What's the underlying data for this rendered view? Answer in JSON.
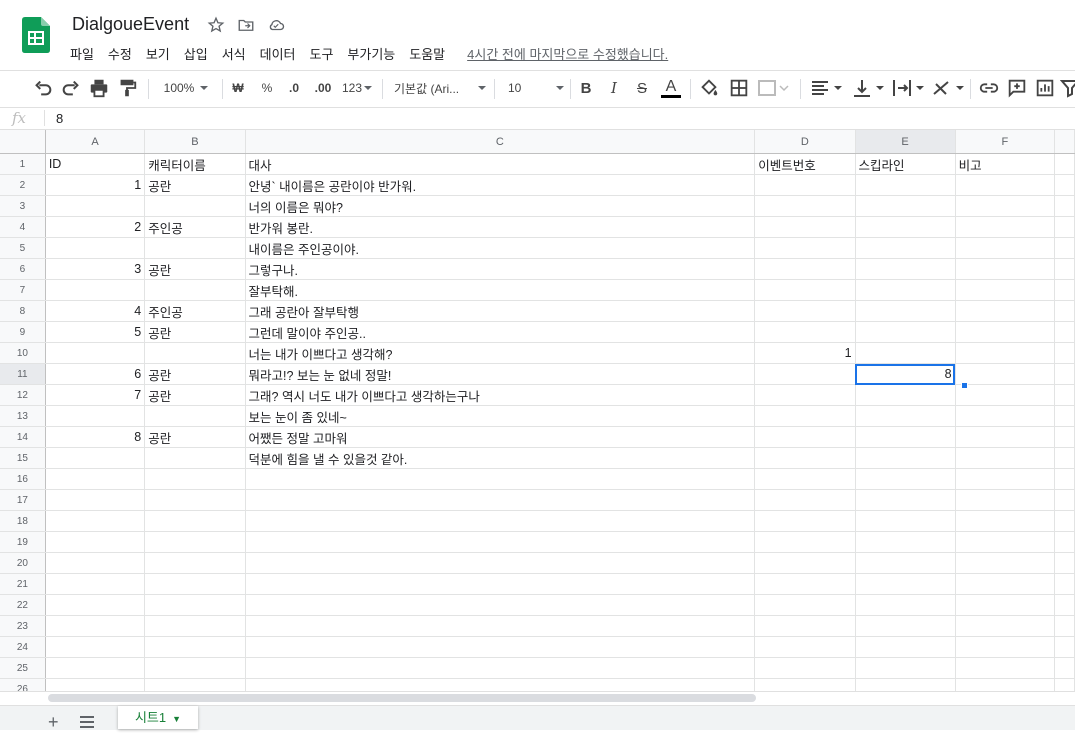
{
  "app": {
    "title": "DialgoueEvent",
    "last_edit": "4시간 전에 마지막으로 수정했습니다.",
    "menu": [
      "파일",
      "수정",
      "보기",
      "삽입",
      "서식",
      "데이터",
      "도구",
      "부가기능",
      "도움말"
    ]
  },
  "toolbar": {
    "zoom": "100%",
    "currency": "₩",
    "percent": "%",
    "decrease_decimal": ".0",
    "increase_decimal": ".00",
    "number_format": "123",
    "font": "기본값 (Ari...",
    "font_size": "10",
    "bold": "B",
    "italic": "I",
    "strike": "S",
    "text_color": "A"
  },
  "formula_bar": {
    "fx": "fx",
    "value": "8"
  },
  "colors": {
    "accent": "#1a73e8",
    "sheets_green": "#188038"
  },
  "grid": {
    "columns": [
      "A",
      "B",
      "C",
      "D",
      "E",
      "F"
    ],
    "row_numbers": [
      "1",
      "2",
      "3",
      "4",
      "5",
      "6",
      "7",
      "8",
      "9",
      "10",
      "11",
      "12",
      "13",
      "14",
      "15",
      "16",
      "17",
      "18",
      "19",
      "20",
      "21",
      "22",
      "23",
      "24",
      "25",
      "26"
    ],
    "rows": [
      [
        "ID",
        "캐릭터이름",
        "대사",
        "이벤트번호",
        "스킵라인",
        "비고"
      ],
      [
        "1",
        "공란",
        "안녕` 내이름은 공란이야 반가워.",
        "",
        "",
        ""
      ],
      [
        "",
        "",
        "너의 이름은 뭐야?",
        "",
        "",
        ""
      ],
      [
        "2",
        "주인공",
        "반가워 봉란.",
        "",
        "",
        ""
      ],
      [
        "",
        "",
        "내이름은 주인공이야.",
        "",
        "",
        ""
      ],
      [
        "3",
        "공란",
        "그렇구나.",
        "",
        "",
        ""
      ],
      [
        "",
        "",
        "잘부탁해.",
        "",
        "",
        ""
      ],
      [
        "4",
        "주인공",
        "그래 공란아 잘부탁행",
        "",
        "",
        ""
      ],
      [
        "5",
        "공란",
        "그런데 말이야 주인공..",
        "",
        "",
        ""
      ],
      [
        "",
        "",
        "너는 내가 이쁘다고 생각해?",
        "1",
        "",
        ""
      ],
      [
        "6",
        "공란",
        "뭐라고!? 보는 눈 없네 정말!",
        "",
        "8",
        ""
      ],
      [
        "7",
        "공란",
        "그래? 역시 너도 내가 이쁘다고 생각하는구나",
        "",
        "",
        ""
      ],
      [
        "",
        "",
        "보는 눈이 좀 있네~",
        "",
        "",
        ""
      ],
      [
        "8",
        "공란",
        "어쨌든 정말 고마워",
        "",
        "",
        ""
      ],
      [
        "",
        "",
        "덕분에 힘을 낼 수 있을것 같아.",
        "",
        "",
        ""
      ],
      [
        "",
        "",
        "",
        "",
        "",
        ""
      ],
      [
        "",
        "",
        "",
        "",
        "",
        ""
      ],
      [
        "",
        "",
        "",
        "",
        "",
        ""
      ],
      [
        "",
        "",
        "",
        "",
        "",
        ""
      ],
      [
        "",
        "",
        "",
        "",
        "",
        ""
      ],
      [
        "",
        "",
        "",
        "",
        "",
        ""
      ],
      [
        "",
        "",
        "",
        "",
        "",
        ""
      ],
      [
        "",
        "",
        "",
        "",
        "",
        ""
      ],
      [
        "",
        "",
        "",
        "",
        "",
        ""
      ],
      [
        "",
        "",
        "",
        "",
        "",
        ""
      ],
      [
        "",
        "",
        "",
        "",
        "",
        ""
      ]
    ]
  },
  "sheets": [
    "시트1"
  ]
}
